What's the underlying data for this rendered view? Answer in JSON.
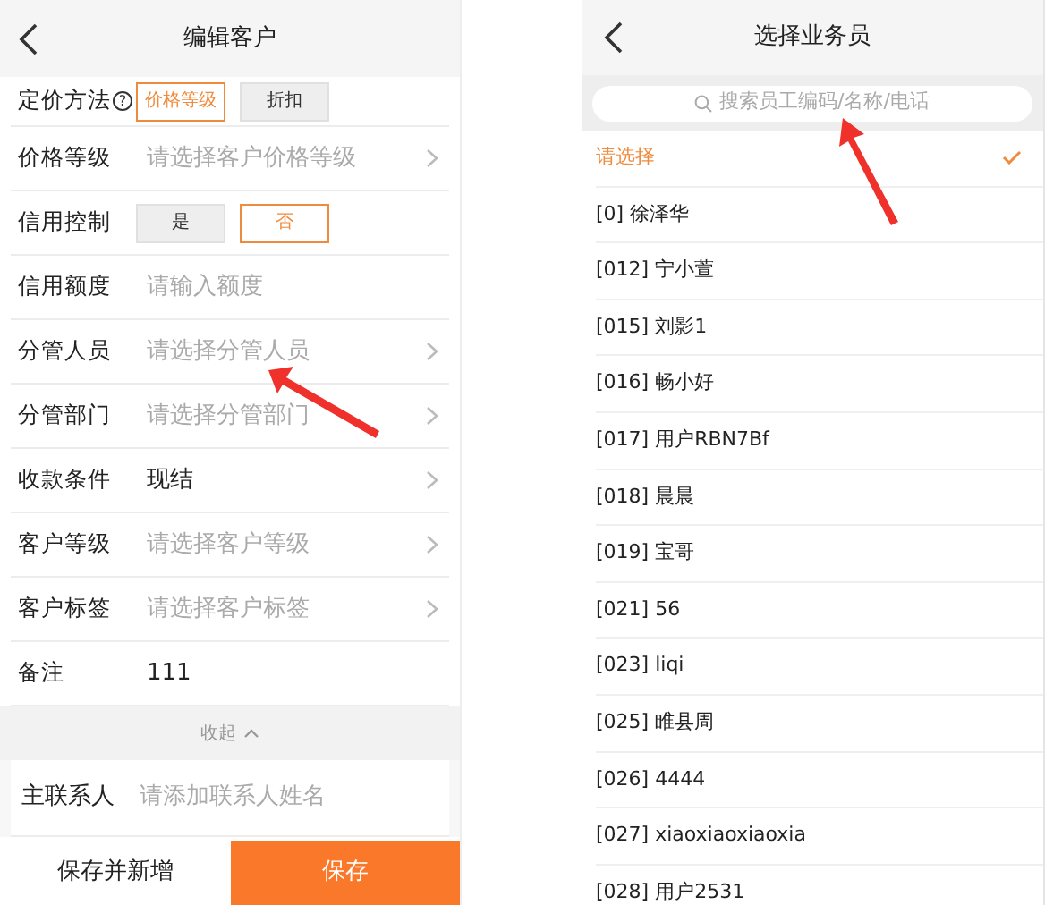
{
  "left": {
    "title": "编辑客户",
    "rows": [
      {
        "kind": "options",
        "label": "定价方法",
        "help": "?",
        "options": [
          {
            "label": "价格等级",
            "selected": true
          },
          {
            "label": "折扣",
            "selected": false
          }
        ]
      },
      {
        "kind": "select",
        "label": "价格等级",
        "placeholder": "请选择客户价格等级"
      },
      {
        "kind": "options",
        "label": "信用控制",
        "options": [
          {
            "label": "是",
            "selected": false
          },
          {
            "label": "否",
            "selected": true
          }
        ]
      },
      {
        "kind": "input",
        "label": "信用额度",
        "placeholder": "请输入额度"
      },
      {
        "kind": "select",
        "label": "分管人员",
        "placeholder": "请选择分管人员"
      },
      {
        "kind": "select",
        "label": "分管部门",
        "placeholder": "请选择分管部门"
      },
      {
        "kind": "select",
        "label": "收款条件",
        "value": "现结"
      },
      {
        "kind": "select",
        "label": "客户等级",
        "placeholder": "请选择客户等级"
      },
      {
        "kind": "select",
        "label": "客户标签",
        "placeholder": "请选择客户标签"
      },
      {
        "kind": "input",
        "label": "备注",
        "value": "111"
      }
    ],
    "collapse": "收起",
    "contact": {
      "label": "主联系人",
      "placeholder": "请添加联系人姓名"
    },
    "buttons": [
      {
        "label": "保存并新增",
        "kind": "secondary"
      },
      {
        "label": "保存",
        "kind": "primary"
      }
    ]
  },
  "right": {
    "title": "选择业务员",
    "search": {
      "placeholder": "搜索员工编码/名称/电话"
    },
    "items": [
      {
        "label": "请选择",
        "selected": true
      },
      {
        "label": "[0] 徐泽华",
        "selected": false
      },
      {
        "label": "[012] 宁小萱",
        "selected": false
      },
      {
        "label": "[015] 刘影1",
        "selected": false
      },
      {
        "label": "[016] 畅小好",
        "selected": false
      },
      {
        "label": "[017] 用户RBN7Bf",
        "selected": false
      },
      {
        "label": "[018] 晨晨",
        "selected": false
      },
      {
        "label": "[019] 宝哥",
        "selected": false
      },
      {
        "label": "[021] 56",
        "selected": false
      },
      {
        "label": "[023] liqi",
        "selected": false
      },
      {
        "label": "[025] 睢县周",
        "selected": false
      },
      {
        "label": "[026] 4444",
        "selected": false
      },
      {
        "label": "[027] xiaoxiaoxiaoxia",
        "selected": false
      },
      {
        "label": "[028] 用户2531",
        "selected": false
      }
    ]
  }
}
